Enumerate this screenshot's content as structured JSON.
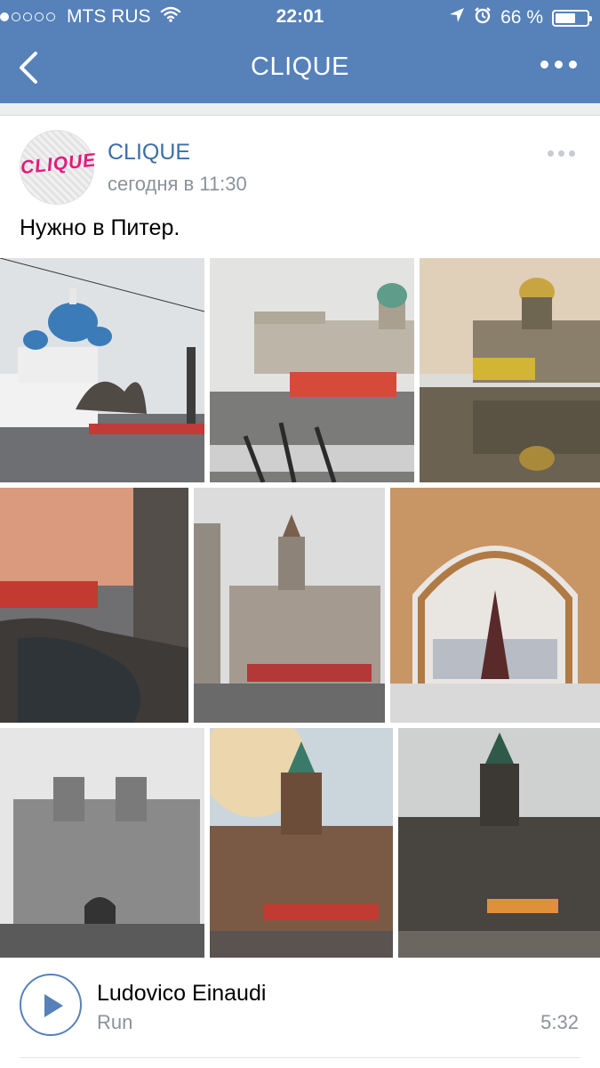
{
  "status_bar": {
    "carrier": "MTS RUS",
    "time": "22:01",
    "battery": "66 %",
    "battery_level": 0.66,
    "signal_bars_filled": 1,
    "signal_bars_total": 5,
    "icons": [
      "wifi-icon",
      "location-arrow-icon",
      "alarm-icon",
      "battery-icon"
    ]
  },
  "nav": {
    "title": "CLIQUE",
    "back_icon": "chevron-left-icon",
    "more_icon": "more-dots-icon"
  },
  "post": {
    "author": "CLIQUE",
    "avatar_text": "CLIQUE",
    "date": "сегодня в 11:30",
    "text": "Нужно в Питер.",
    "photos": [
      {
        "name": "photo-trinity-cathedral",
        "subject": "blue-dome-cathedral"
      },
      {
        "name": "photo-kazan-cathedral",
        "subject": "colonnade-cathedral"
      },
      {
        "name": "photo-st-isaacs-reflection",
        "subject": "gold-dome-reflection"
      },
      {
        "name": "photo-nevsky-crowd",
        "subject": "sunset-street-crowd"
      },
      {
        "name": "photo-corner-building",
        "subject": "spired-corner-building"
      },
      {
        "name": "photo-general-staff-arch",
        "subject": "arch-christmas-tree"
      },
      {
        "name": "photo-tower-building",
        "subject": "twin-tower-building"
      },
      {
        "name": "photo-singer-house-warm",
        "subject": "glass-dome-building-warm"
      },
      {
        "name": "photo-singer-house-dark",
        "subject": "glass-dome-building-dark"
      }
    ]
  },
  "audio": {
    "artist": "Ludovico Einaudi",
    "track": "Run",
    "duration": "5:32",
    "play_icon": "play-icon"
  },
  "colors": {
    "header": "#5681b9",
    "link": "#3b6fa8",
    "secondary_text": "#8c929a",
    "separator": "#edeef0",
    "avatar_text": "#e5197e"
  }
}
